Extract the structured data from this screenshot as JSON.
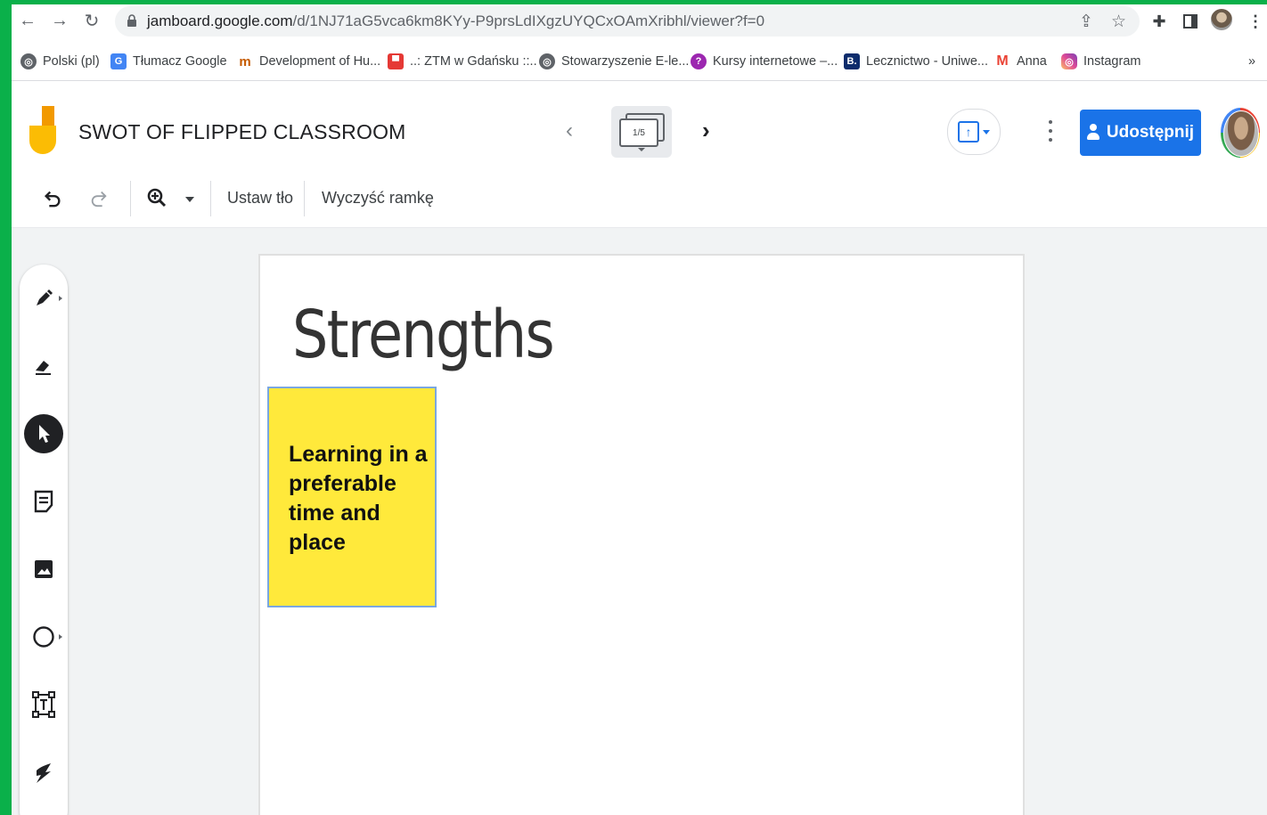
{
  "browser": {
    "url_main": "jamboard.google.com",
    "url_path": "/d/1NJ71aG5vca6km8KYy-P9prsLdIXgzUYQCxOAmXribhl/viewer?f=0",
    "icons": [
      "back-icon",
      "forward-icon",
      "reload-icon",
      "lock-icon",
      "share-page-icon",
      "star-icon",
      "extensions-icon",
      "sidepanel-icon",
      "profile-icon",
      "kebab-icon"
    ]
  },
  "bookmarks": {
    "items": [
      {
        "label": "Polski (pl)",
        "icon": "globe-icon"
      },
      {
        "label": "Tłumacz Google",
        "icon": "translate-icon"
      },
      {
        "label": "Development of Hu...",
        "icon": "mh-icon"
      },
      {
        "label": "..: ZTM w Gdańsku ::..",
        "icon": "ztm-icon"
      },
      {
        "label": "Stowarzyszenie E-le...",
        "icon": "globe-icon"
      },
      {
        "label": "Kursy internetowe –...",
        "icon": "kursy-icon"
      },
      {
        "label": "Lecznictwo - Uniwe...",
        "icon": "b-icon"
      },
      {
        "label": "Anna",
        "icon": "gmail-icon"
      },
      {
        "label": "Instagram",
        "icon": "instagram-icon"
      }
    ],
    "overflow": "»"
  },
  "app": {
    "title": "SWOT OF FLIPPED CLASSROOM",
    "frame_indicator": "1/5",
    "share_label": "Udostępnij"
  },
  "toolbar": {
    "set_background": "Ustaw tło",
    "clear_frame": "Wyczyść ramkę"
  },
  "board": {
    "heading": "Strengths",
    "sticky_note": {
      "text": "Learning in a preferable time and place",
      "color": "#ffe93b"
    }
  },
  "tools": [
    "pen-icon",
    "eraser-icon",
    "select-icon",
    "sticky-note-icon",
    "image-icon",
    "circle-icon",
    "text-box-icon",
    "laser-icon"
  ],
  "colors": {
    "page_border": "#0ab04a",
    "accent": "#1a73e8"
  }
}
